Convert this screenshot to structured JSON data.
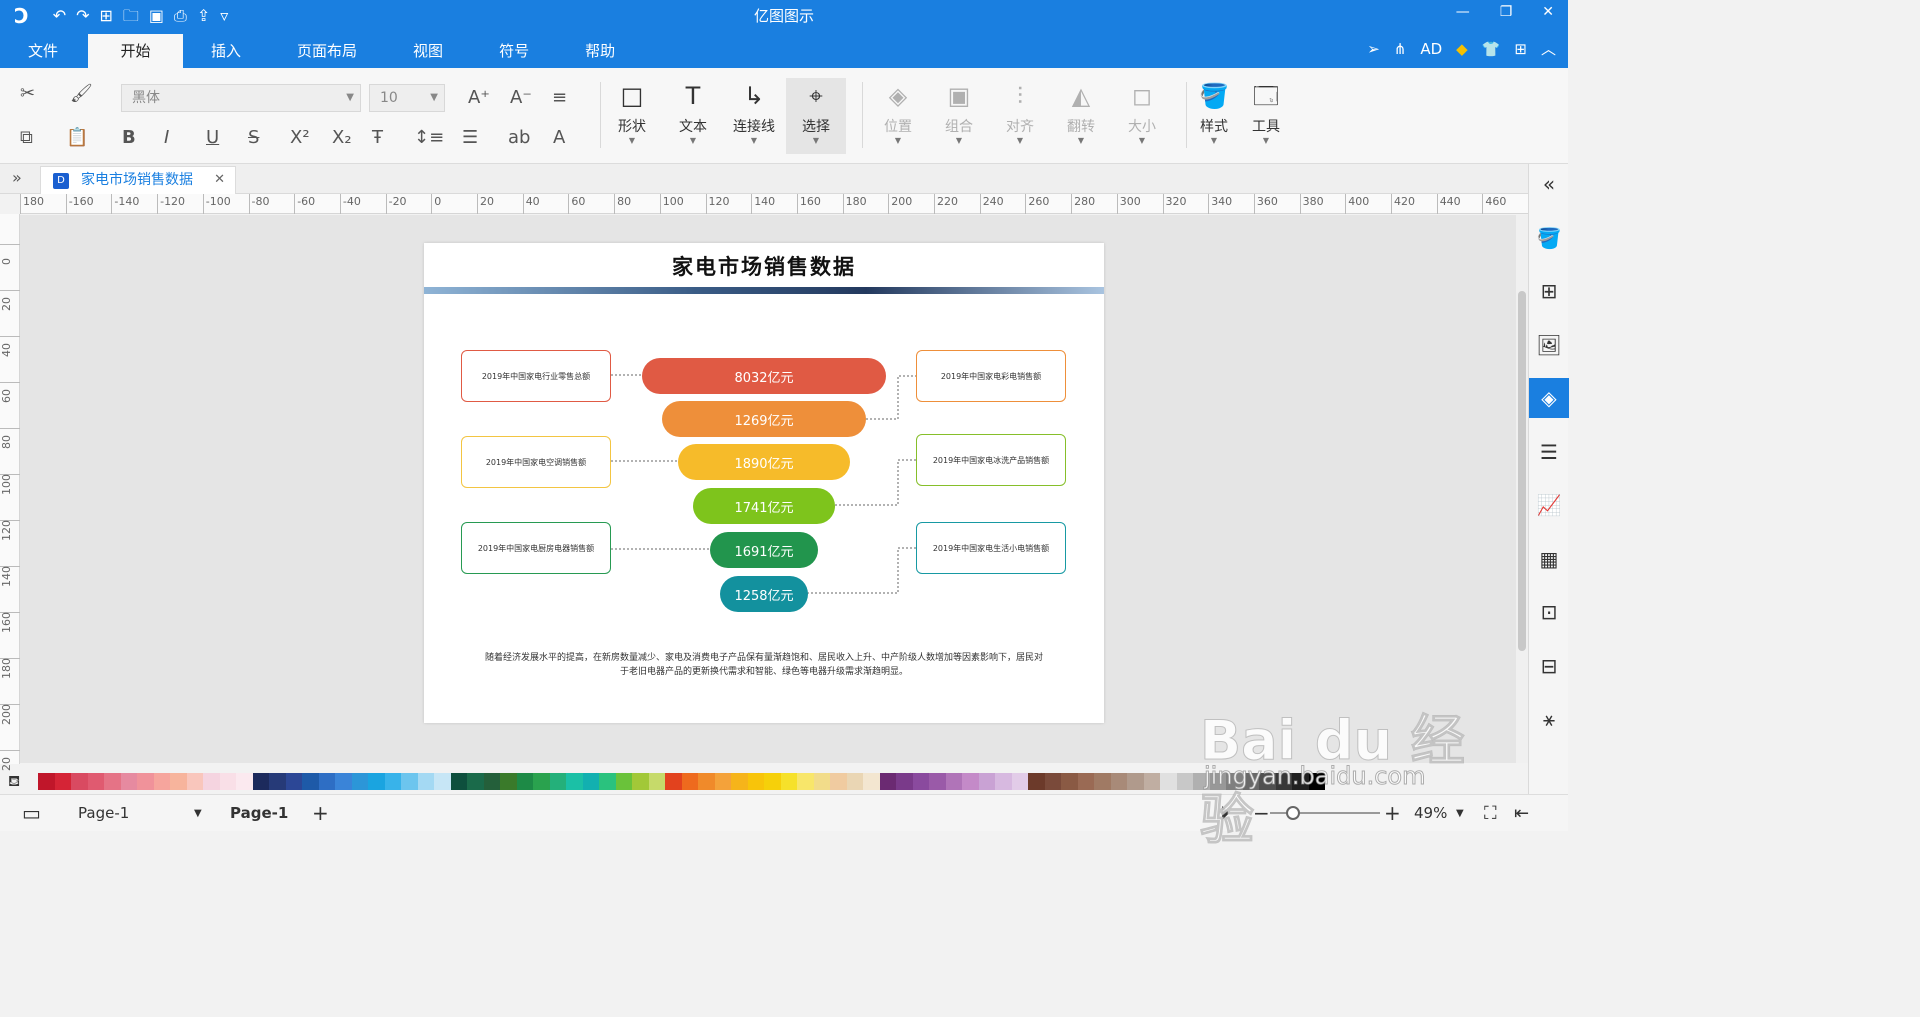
{
  "app": {
    "title": "亿图图示",
    "menu": [
      "文件",
      "开始",
      "插入",
      "页面布局",
      "视图",
      "符号",
      "帮助"
    ],
    "active_menu": "开始",
    "user_label": "AD"
  },
  "ribbon": {
    "font_name": "黑体",
    "font_size": "10",
    "format_icons": [
      "B",
      "I",
      "U",
      "S",
      "X²",
      "X₂"
    ],
    "tools": [
      {
        "label": "形状",
        "icon": "shape-icon",
        "disabled": false,
        "selected": false
      },
      {
        "label": "文本",
        "icon": "text-icon",
        "disabled": false,
        "selected": false
      },
      {
        "label": "连接线",
        "icon": "connector-icon",
        "disabled": false,
        "selected": false
      },
      {
        "label": "选择",
        "icon": "select-icon",
        "disabled": false,
        "selected": true
      },
      {
        "label": "位置",
        "icon": "position-icon",
        "disabled": true,
        "selected": false
      },
      {
        "label": "组合",
        "icon": "group-icon",
        "disabled": true,
        "selected": false
      },
      {
        "label": "对齐",
        "icon": "align-icon",
        "disabled": true,
        "selected": false
      },
      {
        "label": "翻转",
        "icon": "flip-icon",
        "disabled": true,
        "selected": false
      },
      {
        "label": "大小",
        "icon": "size-icon",
        "disabled": true,
        "selected": false
      },
      {
        "label": "样式",
        "icon": "style-icon",
        "disabled": false,
        "selected": false
      },
      {
        "label": "工具",
        "icon": "tools-icon",
        "disabled": false,
        "selected": false
      }
    ]
  },
  "document": {
    "tab_title": "家电市场销售数据"
  },
  "rulers": {
    "horizontal": [
      "180",
      "-160",
      "-140",
      "-120",
      "-100",
      "-80",
      "-60",
      "-40",
      "-20",
      "0",
      "20",
      "40",
      "60",
      "80",
      "100",
      "120",
      "140",
      "160",
      "180",
      "200",
      "220",
      "240",
      "260",
      "280",
      "300",
      "320",
      "340",
      "360",
      "380",
      "400",
      "420",
      "440",
      "460"
    ],
    "vertical": [
      "0",
      "20",
      "40",
      "60",
      "80",
      "100",
      "120",
      "140",
      "160",
      "180",
      "200",
      "20"
    ]
  },
  "diagram": {
    "title": "家电市场销售数据",
    "left_boxes": [
      {
        "text": "2019年中国家电行业零售总额",
        "color": "#e05a44"
      },
      {
        "text": "2019年中国家电空调销售额",
        "color": "#f3c542"
      },
      {
        "text": "2019年中国家电厨房电器销售额",
        "color": "#279a52"
      }
    ],
    "right_boxes": [
      {
        "text": "2019年中国家电彩电销售额",
        "color": "#ee8f3a"
      },
      {
        "text": "2019年中国家电冰洗产品销售额",
        "color": "#86bf2a"
      },
      {
        "text": "2019年中国家电生活小电销售额",
        "color": "#1799a3"
      }
    ],
    "funnel": [
      {
        "value": "8032亿元",
        "color": "#e05a44"
      },
      {
        "value": "1269亿元",
        "color": "#ee8f3a"
      },
      {
        "value": "1890亿元",
        "color": "#f6bb2a"
      },
      {
        "value": "1741亿元",
        "color": "#7ec41c"
      },
      {
        "value": "1691亿元",
        "color": "#22954d"
      },
      {
        "value": "1258亿元",
        "color": "#13919e"
      }
    ],
    "description": "随着经济发展水平的提高，在新房数量减少、家电及消费电子产品保有量渐趋饱和、居民收入上升、中产阶级人数增加等因素影响下，居民对于老旧电器产品的更新换代需求和智能、绿色等电器升级需求渐趋明显。"
  },
  "right_panel": [
    "collapse-icon",
    "fill-icon",
    "library-icon",
    "image-icon",
    "layers-icon",
    "page-icon",
    "chart-icon",
    "table-icon",
    "outline-icon",
    "history-icon",
    "mindmap-icon"
  ],
  "palette": [
    "#c0162a",
    "#d52436",
    "#d94a61",
    "#e05a70",
    "#e57386",
    "#e68aa0",
    "#f0929a",
    "#f6a59d",
    "#f7b49c",
    "#f9c6bc",
    "#f5d4e0",
    "#f9dfe7",
    "#fbe9ef",
    "#1c2a5c",
    "#263a78",
    "#2c4796",
    "#1e5aa8",
    "#2e6ec4",
    "#3a84d8",
    "#2c96d8",
    "#1aa4e0",
    "#38b3ea",
    "#6cc5ee",
    "#a4d9f3",
    "#c7e6f6",
    "#0e4f3d",
    "#1a6a4a",
    "#245f3a",
    "#3a7a2a",
    "#1d8a46",
    "#2aa24e",
    "#24b07a",
    "#1bc0a6",
    "#12b0b0",
    "#2ac27e",
    "#6ac23a",
    "#a2c838",
    "#c6da6a",
    "#e2421e",
    "#ee6a1e",
    "#f08a2a",
    "#f4a23a",
    "#f6b41a",
    "#f8c40a",
    "#f6d00a",
    "#f6e12a",
    "#f8e66a",
    "#f2dc8a",
    "#f0cba0",
    "#ead6b4",
    "#f3e6d0",
    "#6b2a72",
    "#7a3a8a",
    "#8a4a9e",
    "#9a5aa8",
    "#b074b8",
    "#c48ac8",
    "#c9a2d4",
    "#d7b9e0",
    "#e2cce8",
    "#6c3a2a",
    "#7a4a3a",
    "#8a5a44",
    "#9a6a54",
    "#a07a64",
    "#a88a78",
    "#b09a8c",
    "#c0aea2",
    "#e0e0e0",
    "#c8c8c8",
    "#b0b0b0",
    "#989898",
    "#808080",
    "#686868",
    "#505050",
    "#383838",
    "#202020",
    "#000000"
  ],
  "status": {
    "page_selector": "Page-1",
    "active_page": "Page-1",
    "zoom": "49%"
  },
  "watermark": {
    "logo_text": "Bai du 经验",
    "url": "jingyan.baidu.com"
  }
}
